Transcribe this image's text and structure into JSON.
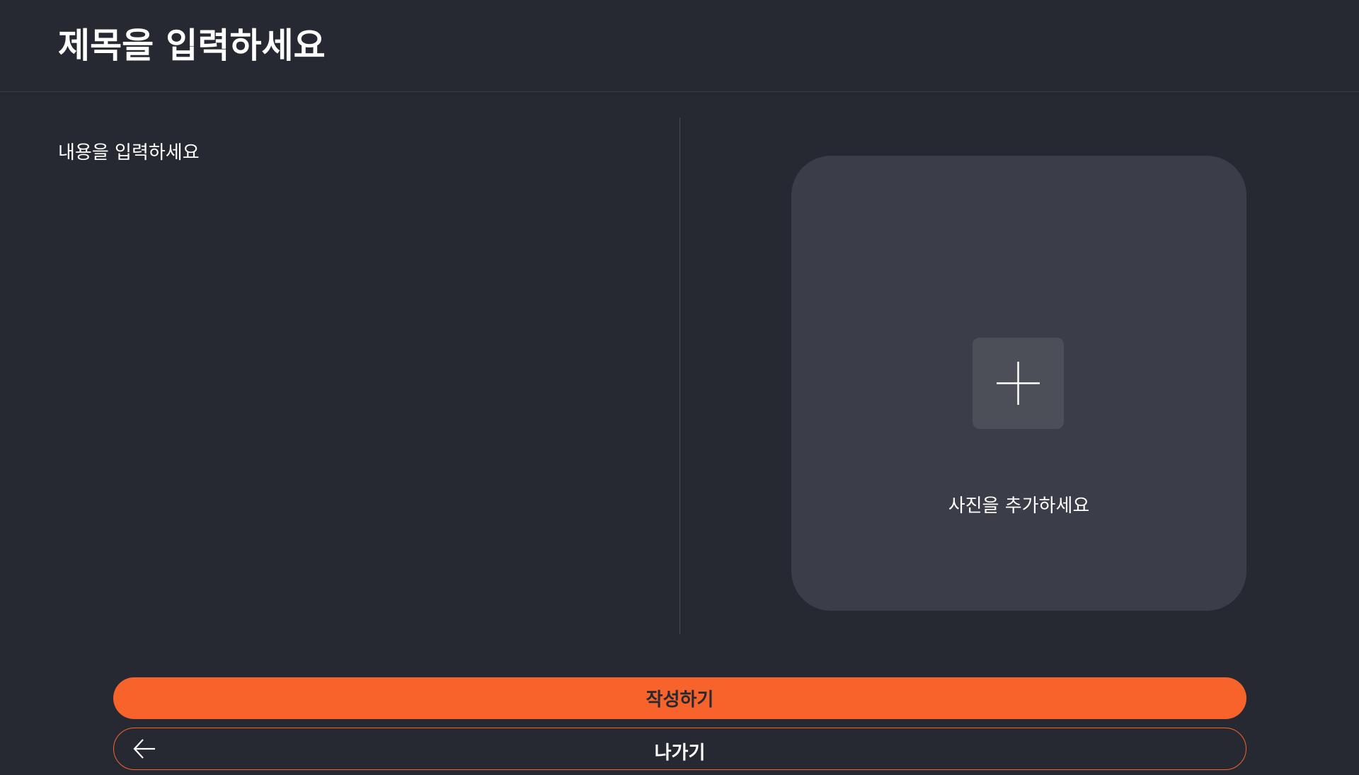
{
  "header": {
    "title_placeholder": "제목을 입력하세요"
  },
  "editor": {
    "content_placeholder": "내용을 입력하세요"
  },
  "photo": {
    "add_icon": "plus-icon",
    "label": "사진을 추가하세요"
  },
  "actions": {
    "submit_label": "작성하기",
    "exit_label": "나가기",
    "exit_icon": "arrow-left-icon"
  },
  "colors": {
    "background": "#262932",
    "panel": "#3b3e48",
    "accent": "#f7632a"
  }
}
